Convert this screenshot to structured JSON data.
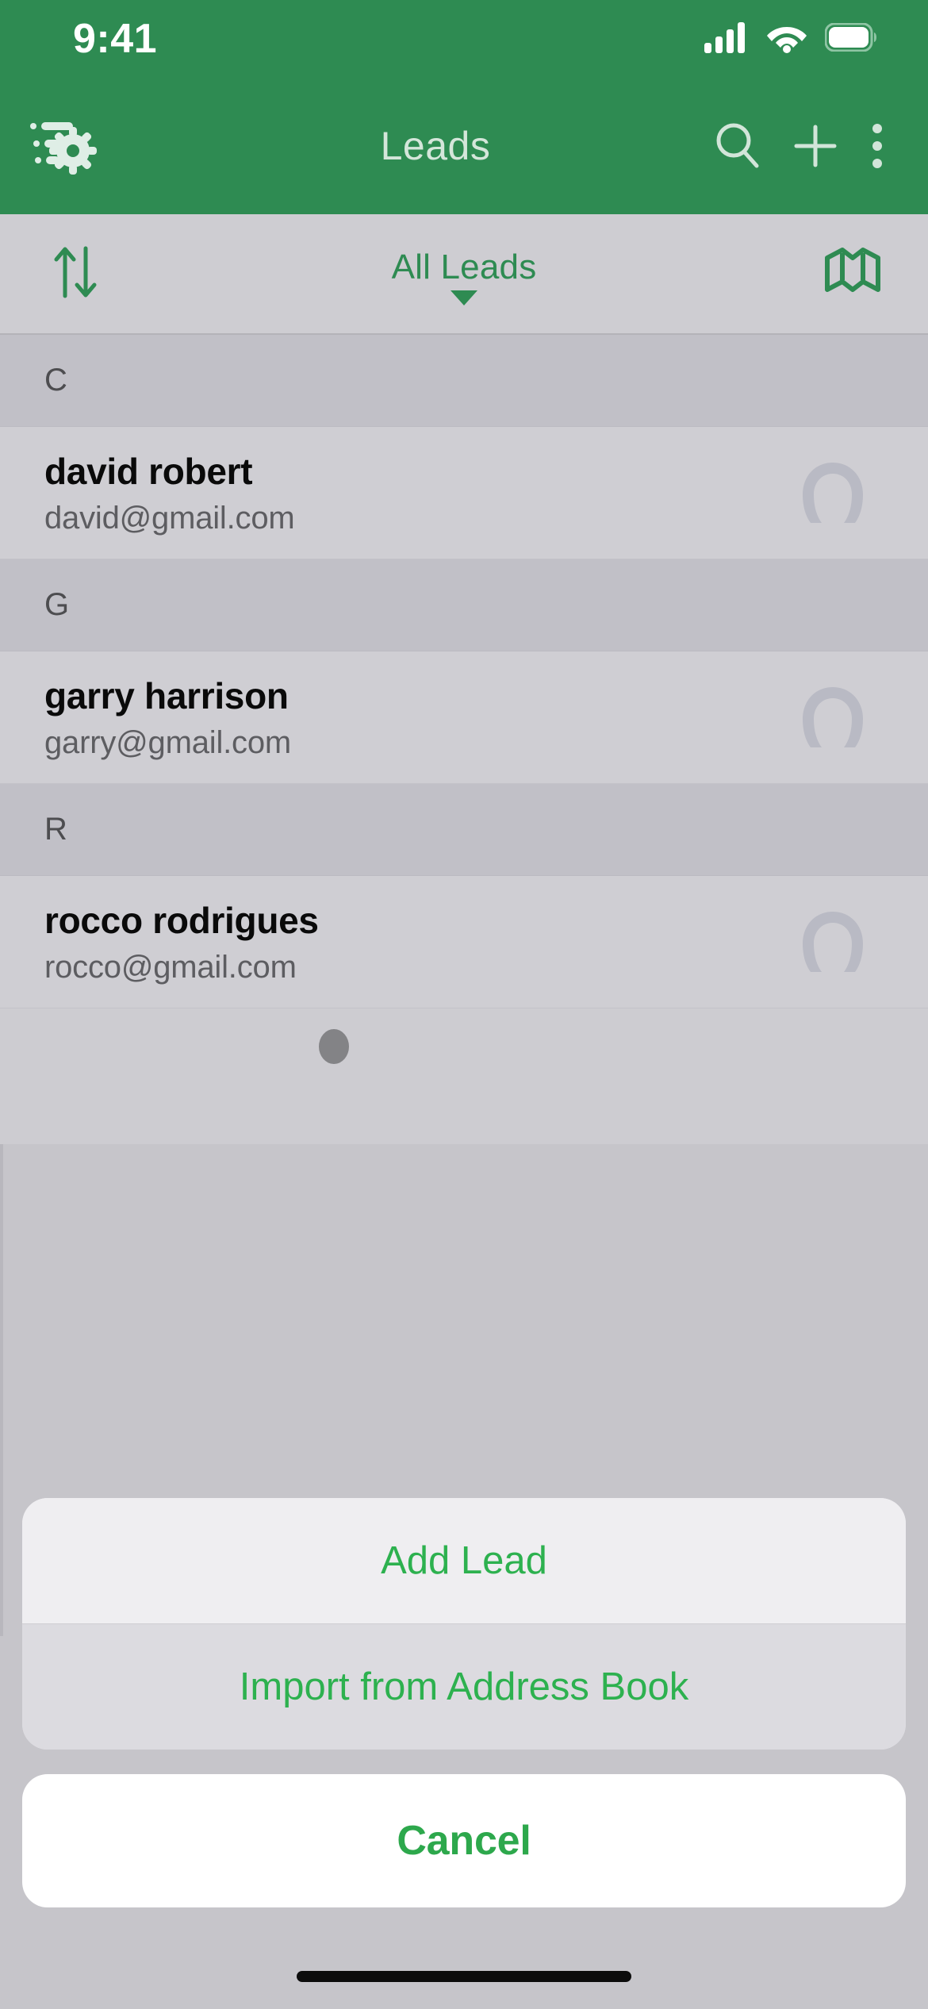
{
  "status_bar": {
    "time": "9:41",
    "icons": [
      "cellular-signal-icon",
      "wifi-icon",
      "battery-icon"
    ],
    "background": "#2e8b52"
  },
  "nav_bar": {
    "title": "Leads",
    "left_icon": "filter-settings-icon",
    "right_icons": [
      "search-icon",
      "add-icon",
      "more-options-icon"
    ],
    "background": "#2e8b52",
    "title_color": "#d4e6da"
  },
  "filter_bar": {
    "sort_icon": "sort-arrows-icon",
    "selected_filter": "All Leads",
    "dropdown_icon": "chevron-down-icon",
    "map_icon": "map-icon",
    "accent_color": "#2e8b52"
  },
  "list": {
    "sections": [
      {
        "letter": "C",
        "rows": [
          {
            "name": "david robert",
            "email": "david@gmail.com",
            "avatar": "person-placeholder-icon"
          }
        ]
      },
      {
        "letter": "G",
        "rows": [
          {
            "name": "garry harrison",
            "email": "garry@gmail.com",
            "avatar": "person-placeholder-icon"
          }
        ]
      },
      {
        "letter": "R",
        "rows": [
          {
            "name": "rocco rodrigues",
            "email": "rocco@gmail.com",
            "avatar": "person-placeholder-icon"
          }
        ]
      }
    ]
  },
  "action_sheet": {
    "options": [
      {
        "label": "Add Lead",
        "state": "pressed"
      },
      {
        "label": "Import from Address Book",
        "state": "normal"
      }
    ],
    "cancel_label": "Cancel",
    "action_color": "#2db14f"
  }
}
